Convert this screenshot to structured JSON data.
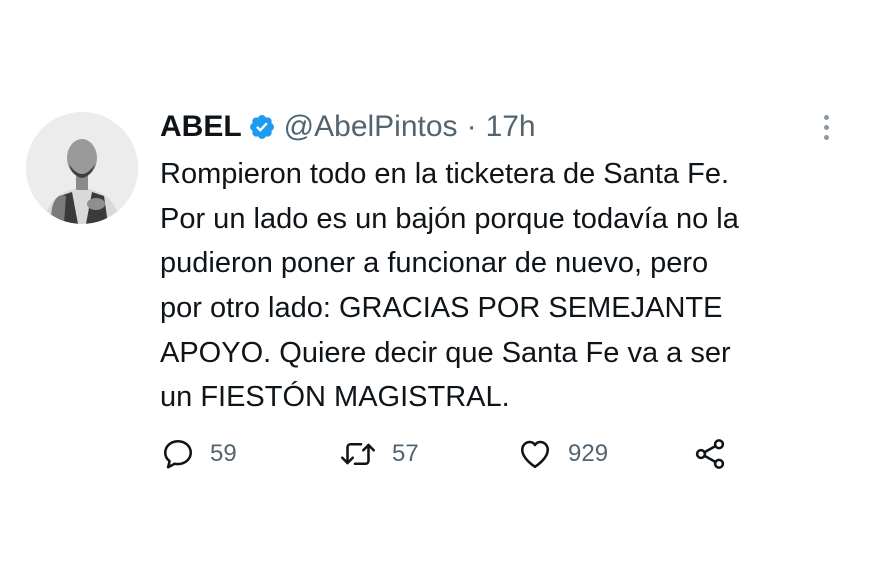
{
  "tweet": {
    "author": {
      "name": "ABEL",
      "handle": "@AbelPintos",
      "separator": "·",
      "time": "17h",
      "verified": true
    },
    "lines": [
      "Rompieron todo en la ticketera de Santa Fe.",
      "Por un lado es un bajón porque todavía no la",
      "pudieron poner a funcionar de nuevo, pero",
      "por otro lado: GRACIAS POR SEMEJANTE",
      "APOYO. Quiere decir que Santa Fe va a ser",
      "un FIESTÓN MAGISTRAL."
    ],
    "stats": {
      "replies": "59",
      "retweets": "57",
      "likes": "929"
    }
  },
  "icons": {
    "verified": "verified-badge-icon",
    "more": "more-options-icon",
    "reply": "reply-icon",
    "retweet": "retweet-icon",
    "like": "heart-icon",
    "share": "share-icon"
  },
  "colors": {
    "text": "#0f1419",
    "secondary": "#536471",
    "verified": "#1d9bf0",
    "background": "#ffffff"
  }
}
